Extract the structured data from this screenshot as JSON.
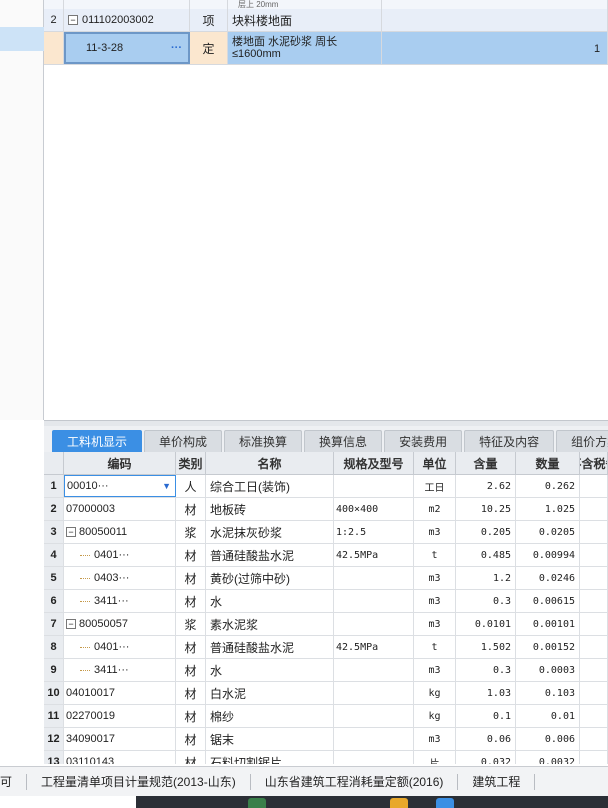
{
  "top_grid": {
    "partial_row": {
      "name_fragment": "层上 20mm"
    },
    "item_row": {
      "row_num": "2",
      "tree_toggle": "−",
      "code": "011102003002",
      "type": "项",
      "name": "块料楼地面"
    },
    "quota_row": {
      "code": "11-3-28",
      "ellipsis": "···",
      "type": "定",
      "name": "楼地面 水泥砂浆 周长≤1600mm",
      "right_value": "1"
    }
  },
  "tabs": [
    {
      "label": "工料机显示",
      "active": true
    },
    {
      "label": "单价构成",
      "active": false
    },
    {
      "label": "标准换算",
      "active": false
    },
    {
      "label": "换算信息",
      "active": false
    },
    {
      "label": "安装费用",
      "active": false
    },
    {
      "label": "特征及内容",
      "active": false
    },
    {
      "label": "组价方案",
      "active": false
    }
  ],
  "resource_grid": {
    "headers": {
      "code": "编码",
      "type": "类别",
      "name": "名称",
      "spec": "规格及型号",
      "unit": "单位",
      "content": "含量",
      "quantity": "数量",
      "tax_excl": "不含税省"
    },
    "rows": [
      {
        "num": "1",
        "code": "00010···",
        "type": "人",
        "name": "综合工日(装饰)",
        "spec": "",
        "unit": "工日",
        "content": "2.62",
        "quantity": "0.262"
      },
      {
        "num": "2",
        "code": "07000003",
        "type": "材",
        "name": "地板砖",
        "spec": "400×400",
        "unit": "m2",
        "content": "10.25",
        "quantity": "1.025"
      },
      {
        "num": "3",
        "code": "80050011",
        "type": "浆",
        "name": "水泥抹灰砂浆",
        "spec": "1:2.5",
        "unit": "m3",
        "content": "0.205",
        "quantity": "0.0205"
      },
      {
        "num": "4",
        "code": "0401···",
        "type": "材",
        "name": "普通硅酸盐水泥",
        "spec": "42.5MPa",
        "unit": "t",
        "content": "0.485",
        "quantity": "0.00994"
      },
      {
        "num": "5",
        "code": "0403···",
        "type": "材",
        "name": "黄砂(过筛中砂)",
        "spec": "",
        "unit": "m3",
        "content": "1.2",
        "quantity": "0.0246"
      },
      {
        "num": "6",
        "code": "3411···",
        "type": "材",
        "name": "水",
        "spec": "",
        "unit": "m3",
        "content": "0.3",
        "quantity": "0.00615"
      },
      {
        "num": "7",
        "code": "80050057",
        "type": "浆",
        "name": "素水泥浆",
        "spec": "",
        "unit": "m3",
        "content": "0.0101",
        "quantity": "0.00101"
      },
      {
        "num": "8",
        "code": "0401···",
        "type": "材",
        "name": "普通硅酸盐水泥",
        "spec": "42.5MPa",
        "unit": "t",
        "content": "1.502",
        "quantity": "0.00152"
      },
      {
        "num": "9",
        "code": "3411···",
        "type": "材",
        "name": "水",
        "spec": "",
        "unit": "m3",
        "content": "0.3",
        "quantity": "0.0003"
      },
      {
        "num": "10",
        "code": "04010017",
        "type": "材",
        "name": "白水泥",
        "spec": "",
        "unit": "kg",
        "content": "1.03",
        "quantity": "0.103"
      },
      {
        "num": "11",
        "code": "02270019",
        "type": "材",
        "name": "棉纱",
        "spec": "",
        "unit": "kg",
        "content": "0.1",
        "quantity": "0.01"
      },
      {
        "num": "12",
        "code": "34090017",
        "type": "材",
        "name": "锯末",
        "spec": "",
        "unit": "m3",
        "content": "0.06",
        "quantity": "0.006"
      },
      {
        "num": "13",
        "code": "03110143",
        "type": "材",
        "name": "石料切割锯片",
        "spec": "",
        "unit": "片",
        "content": "0.032",
        "quantity": "0.0032"
      }
    ]
  },
  "statusbar": {
    "left_fragment": "可",
    "spec_standard": "工程量清单项目计量规范(2013-山东)",
    "quota_standard": "山东省建筑工程消耗量定额(2016)",
    "discipline": "建筑工程"
  }
}
